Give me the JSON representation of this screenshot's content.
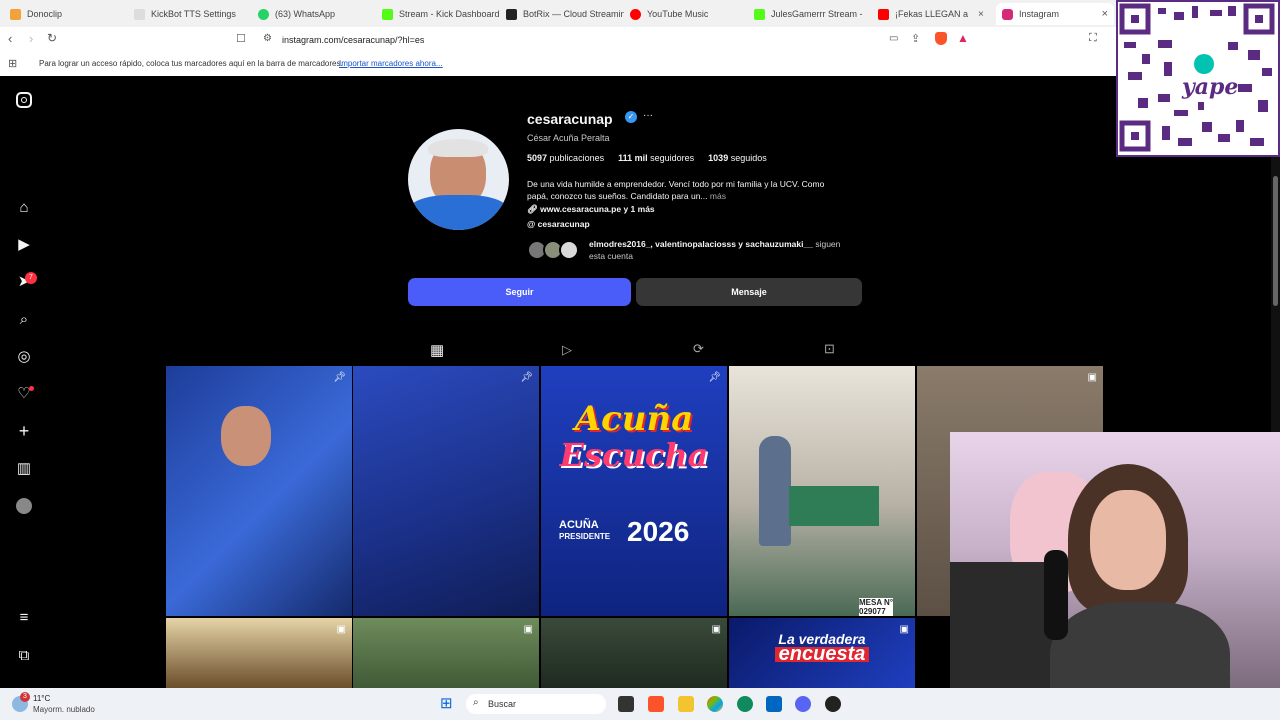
{
  "browser": {
    "tabs": [
      {
        "label": "Donoclip",
        "color": "#f2a23a"
      },
      {
        "label": "KickBot TTS Settings",
        "color": "#e8e8e8"
      },
      {
        "label": "(63) WhatsApp",
        "color": "#25d366"
      },
      {
        "label": "Stream - Kick Dashboard",
        "color": "#53fc18"
      },
      {
        "label": "BotRix — Cloud Streamin",
        "color": "#222222"
      },
      {
        "label": "YouTube Music",
        "color": "#ff0000"
      },
      {
        "label": "JulesGamerrr Stream - W",
        "color": "#53fc18"
      },
      {
        "label": "¡Fekas LLEGAN a",
        "color": "#ff0000"
      },
      {
        "label": "Instagram",
        "color": "#d62976"
      }
    ],
    "url": "instagram.com/cesaracunap/?hl=es",
    "bookmarks_text": "Para lograr un acceso rápido, coloca tus marcadores aquí en la barra de marcadores.",
    "bookmarks_link": "Importar marcadores ahora..."
  },
  "profile": {
    "username": "cesaracunap",
    "full_name": "César Acuña Peralta",
    "posts_count": "5097",
    "posts_label": "publicaciones",
    "followers_count": "111 mil",
    "followers_label": "seguidores",
    "following_count": "1039",
    "following_label": "seguidos",
    "bio_line1": "De una vida humilde a emprendedor. Vencí todo por mi familia y la UCV. Como",
    "bio_line2": "papá, conozco tus sueños. Candidato para un...",
    "bio_more": "más",
    "link": "www.cesaracuna.pe y 1 más",
    "threads": "cesaracunap",
    "followed_by_names": "elmodres2016_, valentinopalaciosss y sachauzumaki__",
    "followed_by_suffix": "siguen",
    "followed_by_line2": "esta cuenta",
    "follow_button": "Seguir",
    "message_button": "Mensaje",
    "notification_badge": "7"
  },
  "posts": {
    "post3_title_1": "Acuña",
    "post3_title_2": "Escucha",
    "post3_sub_1": "ACUÑA",
    "post3_sub_2": "PRESIDENTE",
    "post3_year": "2026",
    "post9_line1": "La verdadera",
    "post9_line2": "encuesta",
    "post4_table": "MESA N°",
    "post4_number": "029077"
  },
  "overlay": {
    "qr_label": "yape"
  },
  "taskbar": {
    "weather_temp": "11°C",
    "weather_desc": "Mayorm. nublado",
    "weather_badge": "3",
    "search_placeholder": "Buscar"
  }
}
